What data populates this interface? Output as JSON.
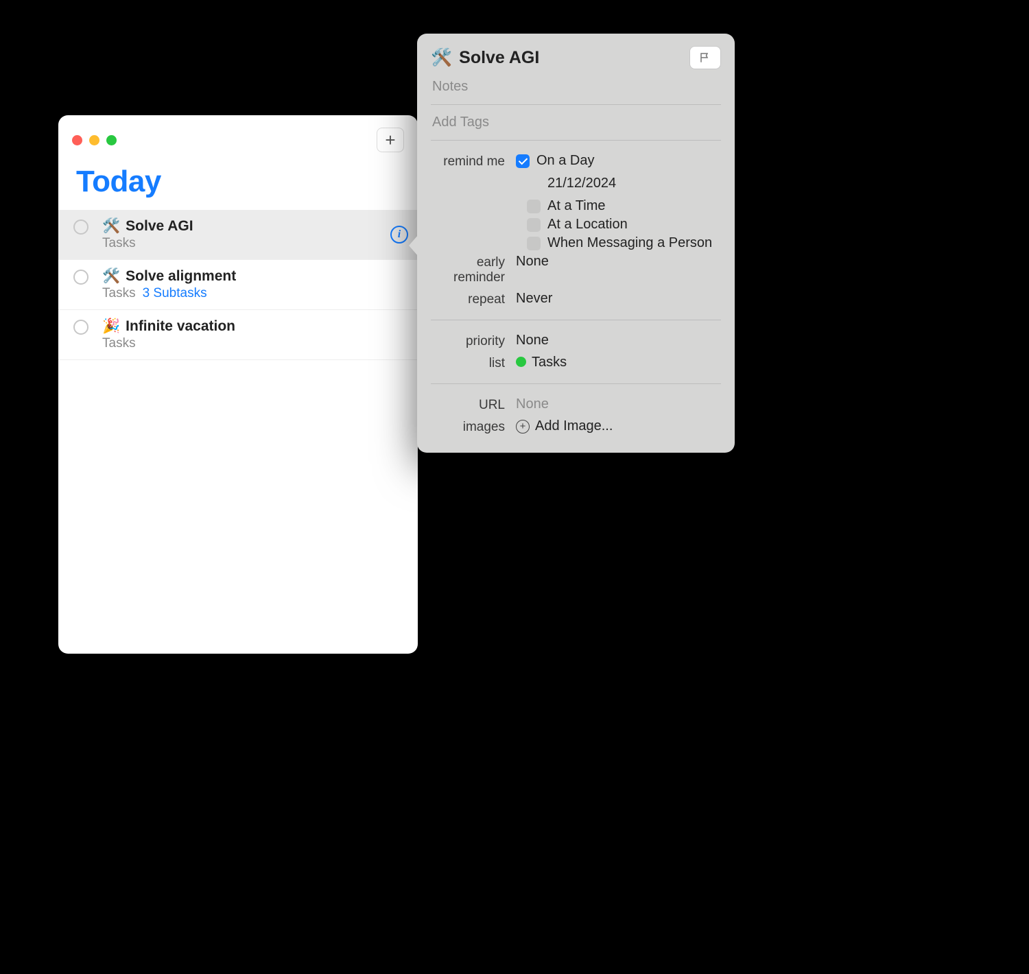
{
  "window": {
    "title": "Today",
    "tasks": [
      {
        "emoji": "🛠️",
        "title": "Solve AGI",
        "list": "Tasks",
        "subtasks": null,
        "selected": true,
        "show_info": true
      },
      {
        "emoji": "🛠️",
        "title": "Solve alignment",
        "list": "Tasks",
        "subtasks": "3 Subtasks",
        "selected": false,
        "show_info": false
      },
      {
        "emoji": "🎉",
        "title": "Infinite vacation",
        "list": "Tasks",
        "subtasks": null,
        "selected": false,
        "show_info": false
      }
    ]
  },
  "popover": {
    "emoji": "🛠️",
    "title": "Solve AGI",
    "notes_placeholder": "Notes",
    "tags_placeholder": "Add Tags",
    "remind": {
      "label": "remind me",
      "options": [
        {
          "label": "On a Day",
          "checked": true
        },
        {
          "label": "At a Time",
          "checked": false
        },
        {
          "label": "At a Location",
          "checked": false
        },
        {
          "label": "When Messaging a Person",
          "checked": false
        }
      ],
      "date": "21/12/2024"
    },
    "early_reminder": {
      "label": "early reminder",
      "value": "None"
    },
    "repeat": {
      "label": "repeat",
      "value": "Never"
    },
    "priority": {
      "label": "priority",
      "value": "None"
    },
    "list": {
      "label": "list",
      "value": "Tasks"
    },
    "url": {
      "label": "URL",
      "value": "None"
    },
    "images": {
      "label": "images",
      "value": "Add Image..."
    }
  }
}
